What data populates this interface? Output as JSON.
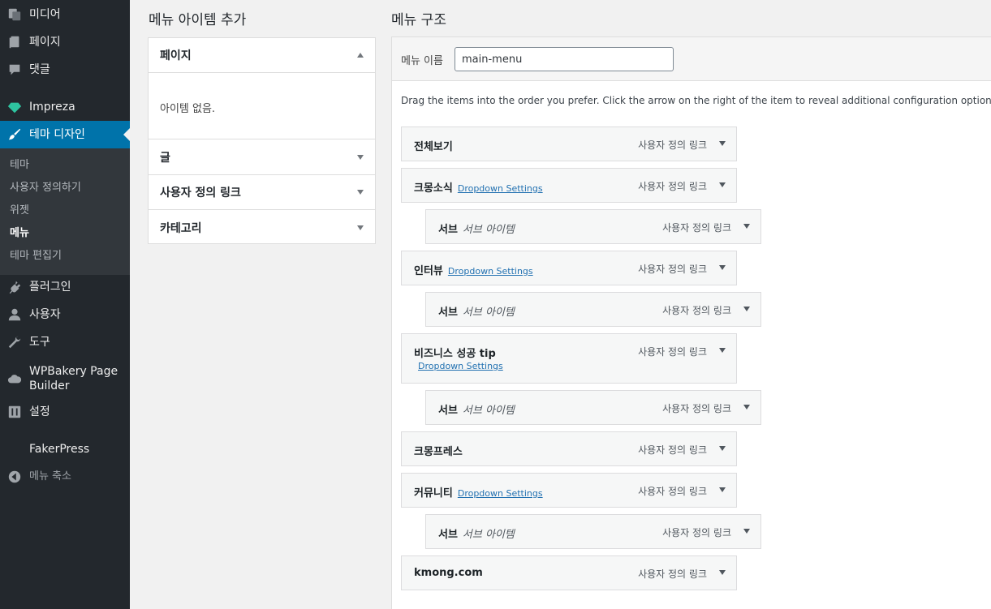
{
  "sidebar": {
    "items": [
      {
        "label": "미디어",
        "icon": "media-icon"
      },
      {
        "label": "페이지",
        "icon": "page-icon"
      },
      {
        "label": "댓글",
        "icon": "comment-icon"
      },
      {
        "label": "Impreza",
        "icon": "diamond-icon"
      },
      {
        "label": "테마 디자인",
        "icon": "paintbrush-icon"
      },
      {
        "label": "플러그인",
        "icon": "plugin-icon"
      },
      {
        "label": "사용자",
        "icon": "user-icon"
      },
      {
        "label": "도구",
        "icon": "wrench-icon"
      },
      {
        "label": "WPBakery Page Builder",
        "icon": "cloud-icon"
      },
      {
        "label": "설정",
        "icon": "settings-icon"
      },
      {
        "label": "FakerPress",
        "icon": ""
      }
    ],
    "submenu": [
      "테마",
      "사용자 정의하기",
      "위젯",
      "메뉴",
      "테마 편집기"
    ],
    "collapse_label": "메뉴 축소"
  },
  "add_items": {
    "title": "메뉴 아이템 추가",
    "sections": [
      {
        "label": "페이지",
        "open": true,
        "body": "아이템 없음."
      },
      {
        "label": "글"
      },
      {
        "label": "사용자 정의 링크"
      },
      {
        "label": "카테고리"
      }
    ]
  },
  "structure": {
    "title": "메뉴 구조",
    "name_label": "메뉴 이름",
    "name_value": "main-menu",
    "instructions": "Drag the items into the order you prefer. Click the arrow on the right of the item to reveal additional configuration options.",
    "items": [
      {
        "title": "전체보기",
        "type": "사용자 정의 링크"
      },
      {
        "title": "크몽소식",
        "dropdown": "Dropdown Settings",
        "type": "사용자 정의 링크"
      },
      {
        "title": "서브",
        "subtitle": "서브 아이템",
        "type": "사용자 정의 링크"
      },
      {
        "title": "인터뷰",
        "dropdown": "Dropdown Settings",
        "type": "사용자 정의 링크"
      },
      {
        "title": "서브",
        "subtitle": "서브 아이템",
        "type": "사용자 정의 링크"
      },
      {
        "title": "비즈니스 성공 tip",
        "dropdown": "Dropdown Settings",
        "type": "사용자 정의 링크"
      },
      {
        "title": "서브",
        "subtitle": "서브 아이템",
        "type": "사용자 정의 링크"
      },
      {
        "title": "크몽프레스",
        "type": "사용자 정의 링크"
      },
      {
        "title": "커뮤니티",
        "dropdown": "Dropdown Settings",
        "type": "사용자 정의 링크"
      },
      {
        "title": "서브",
        "subtitle": "서브 아이템",
        "type": "사용자 정의 링크"
      },
      {
        "title": "kmong.com",
        "type": "사용자 정의 링크"
      }
    ]
  },
  "colors": {
    "sidebar_bg": "#23282d",
    "active": "#0073aa",
    "submenu_bg": "#32373c",
    "link": "#2271b1"
  }
}
